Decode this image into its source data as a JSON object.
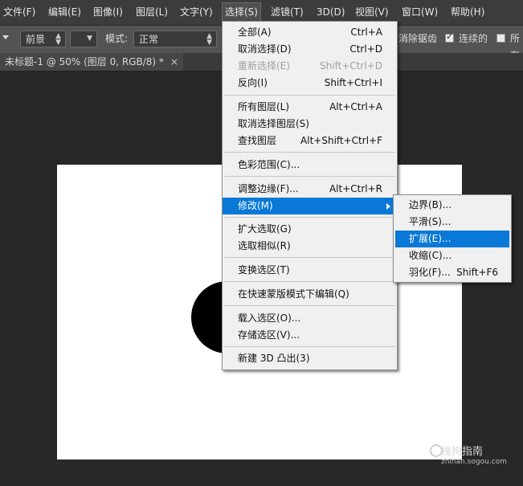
{
  "menubar": {
    "items": [
      "文件(F)",
      "编辑(E)",
      "图像(I)",
      "图层(L)",
      "文字(Y)",
      "选择(S)",
      "滤镜(T)",
      "3D(D)",
      "视图(V)",
      "窗口(W)",
      "帮助(H)"
    ]
  },
  "options": {
    "fill_value": "前景",
    "mode_label": "模式:",
    "mode_value": "正常",
    "antialias_label": "消除锯齿",
    "contiguous_label": "连续的",
    "all_layers_label": "所有"
  },
  "document_tab": {
    "title": "未标题-1 @ 50% (图层 0, RGB/8) *",
    "close": "×"
  },
  "select_menu": {
    "items": [
      {
        "label": "全部(A)",
        "shortcut": "Ctrl+A"
      },
      {
        "label": "取消选择(D)",
        "shortcut": "Ctrl+D"
      },
      {
        "label": "重新选择(E)",
        "shortcut": "Shift+Ctrl+D"
      },
      {
        "label": "反向(I)",
        "shortcut": "Shift+Ctrl+I"
      },
      {
        "label": "所有图层(L)",
        "shortcut": "Alt+Ctrl+A"
      },
      {
        "label": "取消选择图层(S)",
        "shortcut": ""
      },
      {
        "label": "查找图层",
        "shortcut": "Alt+Shift+Ctrl+F"
      },
      {
        "label": "色彩范围(C)...",
        "shortcut": ""
      },
      {
        "label": "调整边缘(F)...",
        "shortcut": "Alt+Ctrl+R"
      },
      {
        "label": "修改(M)",
        "shortcut": ""
      },
      {
        "label": "扩大选取(G)",
        "shortcut": ""
      },
      {
        "label": "选取相似(R)",
        "shortcut": ""
      },
      {
        "label": "变换选区(T)",
        "shortcut": ""
      },
      {
        "label": "在快速蒙版模式下编辑(Q)",
        "shortcut": ""
      },
      {
        "label": "载入选区(O)...",
        "shortcut": ""
      },
      {
        "label": "存储选区(V)...",
        "shortcut": ""
      },
      {
        "label": "新建 3D 凸出(3)",
        "shortcut": ""
      }
    ]
  },
  "modify_submenu": {
    "items": [
      {
        "label": "边界(B)...",
        "shortcut": ""
      },
      {
        "label": "平滑(S)...",
        "shortcut": ""
      },
      {
        "label": "扩展(E)...",
        "shortcut": ""
      },
      {
        "label": "收缩(C)...",
        "shortcut": ""
      },
      {
        "label": "羽化(F)...",
        "shortcut": "Shift+F6"
      }
    ]
  },
  "watermark": {
    "brand": "搜狗指南",
    "url": "zhinan.sogou.com"
  }
}
